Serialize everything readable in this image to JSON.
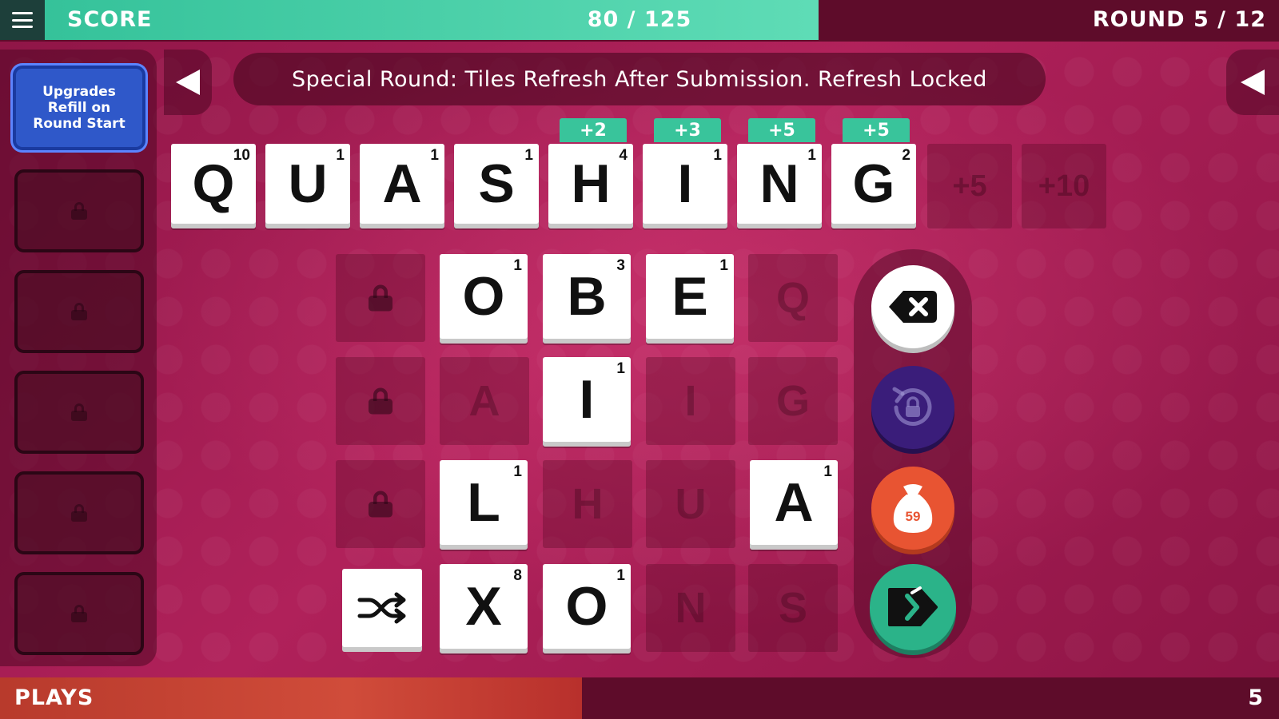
{
  "header": {
    "score_label": "SCORE",
    "score_value": "80 / 125",
    "score_progress": 0.64,
    "round_label": "ROUND 5 / 12"
  },
  "banner": {
    "text": "Special Round: Tiles Refresh After Submission. Refresh Locked"
  },
  "upgrades": {
    "active_card": "Upgrades Refill on Round Start",
    "locked_slots": 5
  },
  "word": {
    "tiles": [
      {
        "letter": "Q",
        "points": "10",
        "bonus": ""
      },
      {
        "letter": "U",
        "points": "1",
        "bonus": ""
      },
      {
        "letter": "A",
        "points": "1",
        "bonus": ""
      },
      {
        "letter": "S",
        "points": "1",
        "bonus": ""
      },
      {
        "letter": "H",
        "points": "4",
        "bonus": "+2"
      },
      {
        "letter": "I",
        "points": "1",
        "bonus": "+3"
      },
      {
        "letter": "N",
        "points": "1",
        "bonus": "+5"
      },
      {
        "letter": "G",
        "points": "2",
        "bonus": "+5"
      }
    ],
    "empty_slots": [
      "+5",
      "+10"
    ]
  },
  "rack": {
    "row1": [
      {
        "ghost": "",
        "locked": true
      },
      {
        "letter": "O",
        "points": "1"
      },
      {
        "letter": "B",
        "points": "3"
      },
      {
        "letter": "E",
        "points": "1"
      },
      {
        "ghost": "Q"
      }
    ],
    "row2": [
      {
        "ghost": "",
        "locked": true
      },
      {
        "ghost": "A"
      },
      {
        "letter": "I",
        "points": "1"
      },
      {
        "ghost": "I"
      },
      {
        "ghost": "G"
      }
    ],
    "row3": [
      {
        "ghost": "",
        "locked": true
      },
      {
        "letter": "L",
        "points": "1"
      },
      {
        "ghost": "H"
      },
      {
        "ghost": "U"
      },
      {
        "letter": "A",
        "points": "1"
      }
    ],
    "row4": [
      {
        "shuffle": true
      },
      {
        "letter": "X",
        "points": "8"
      },
      {
        "letter": "O",
        "points": "1"
      },
      {
        "ghost": "N"
      },
      {
        "ghost": "S"
      }
    ]
  },
  "actions": {
    "bag_count": "59"
  },
  "footer": {
    "plays_label": "PLAYS",
    "plays_value": "5",
    "plays_progress": 0.455
  },
  "colors": {
    "accent_green": "#35c29a",
    "upgrade_blue": "#2f58c9",
    "bag_orange": "#e85432",
    "refresh_purple": "#3a1d7a",
    "plays_red": "#c8422f"
  }
}
